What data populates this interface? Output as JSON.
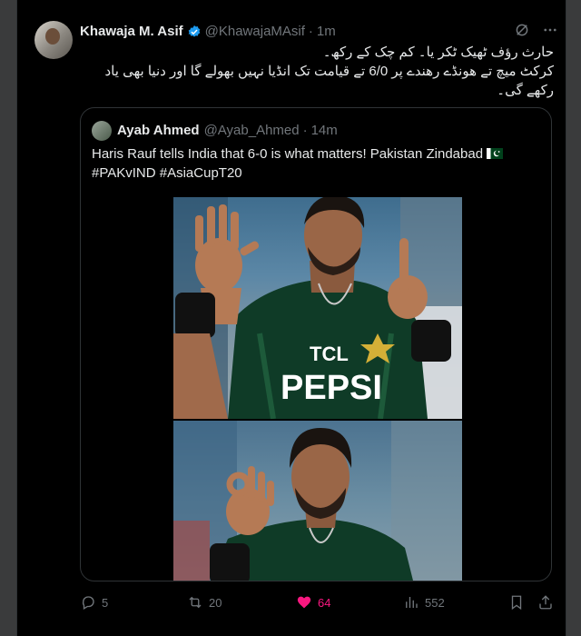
{
  "tweet": {
    "author_name": "Khawaja M. Asif",
    "author_handle": "@KhawajaMAsif",
    "separator": "·",
    "time": "1m",
    "text_lines": [
      "حارث رؤف ٹھیک  ٹکر یا۔ کم چک کے رکھ۔",
      "کرکٹ میچ تے ھونڈے رھندے پر 6/0 تے قیامت تک انڈیا نہیں بھولے گا اور دنیا بھی یاد",
      "رکھے گی۔"
    ]
  },
  "quoted": {
    "author_name": "Ayab Ahmed",
    "author_handle": "@Ayab_Ahmed",
    "separator": "·",
    "time": "14m",
    "text_line1": "Haris Rauf tells India that 6-0 is what matters! Pakistan Zindabad",
    "text_line2": "#PAKvIND #AsiaCupT20",
    "jersey": {
      "sponsor1": "TCL",
      "sponsor2": "PEPSI"
    }
  },
  "actions": {
    "replies": "5",
    "reposts": "20",
    "likes": "64",
    "views": "552"
  },
  "icons": [
    "verified-badge-icon",
    "grok-icon",
    "more-icon",
    "reply-icon",
    "repost-icon",
    "like-icon",
    "views-icon",
    "bookmark-icon",
    "share-icon",
    "pakistan-flag-icon"
  ],
  "colors": {
    "background": "#000000",
    "accent_like": "#f91880",
    "verified": "#1d9bf0",
    "muted": "#71767b"
  }
}
